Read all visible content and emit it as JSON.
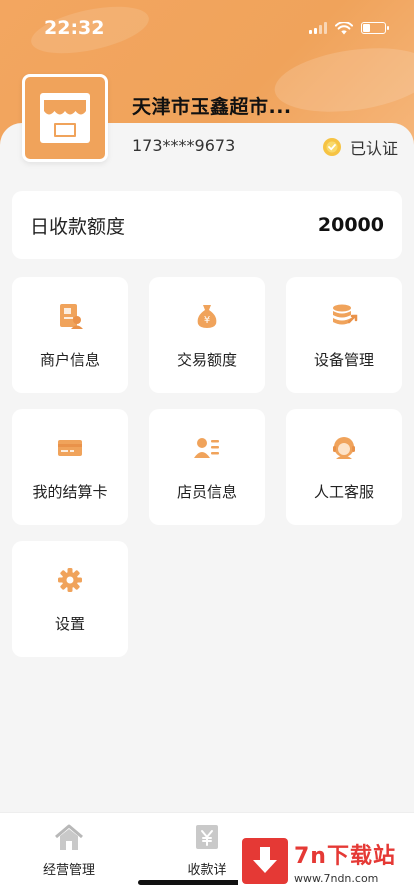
{
  "status_bar": {
    "time": "22:32"
  },
  "merchant": {
    "name": "天津市玉鑫超市...",
    "phone": "173****9673",
    "verified_label": "已认证"
  },
  "quota": {
    "label": "日收款额度",
    "value": "20000"
  },
  "menu": [
    {
      "label": "商户信息",
      "icon": "merchant-info-icon"
    },
    {
      "label": "交易额度",
      "icon": "money-bag-icon"
    },
    {
      "label": "设备管理",
      "icon": "device-icon"
    },
    {
      "label": "我的结算卡",
      "icon": "card-icon"
    },
    {
      "label": "店员信息",
      "icon": "staff-icon"
    },
    {
      "label": "人工客服",
      "icon": "support-icon"
    },
    {
      "label": "设置",
      "icon": "gear-icon"
    }
  ],
  "tabs": [
    {
      "label": "经营管理",
      "icon": "home-icon"
    },
    {
      "label": "收款详",
      "icon": "yen-icon"
    },
    {
      "label": "",
      "icon": "profile-icon"
    }
  ],
  "watermark": {
    "title": "7n下载站",
    "url": "www.7ndn.com"
  },
  "colors": {
    "accent": "#f0a35b",
    "background": "#f5f5f5",
    "watermark_red": "#e53935"
  }
}
